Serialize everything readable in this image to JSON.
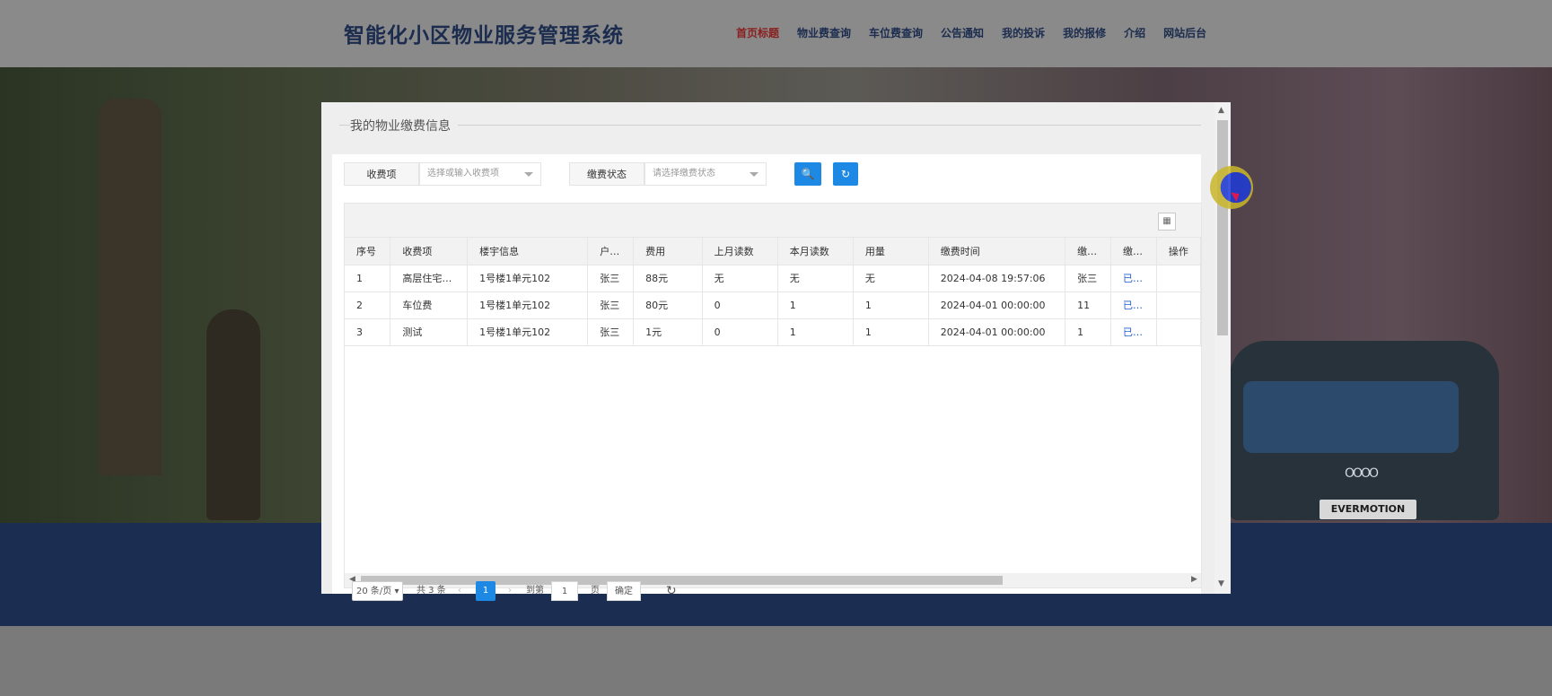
{
  "header": {
    "site_title": "智能化小区物业服务管理系统",
    "nav": [
      "首页标题",
      "物业费查询",
      "车位费查询",
      "公告通知",
      "我的投诉",
      "我的报修",
      "介绍",
      "网站后台"
    ],
    "active_index": 0,
    "active_color": "#8a1f1f"
  },
  "backdrop": {
    "car_logo": "OOOO",
    "plate": "EVERMOTION"
  },
  "modal": {
    "title": "我的物业缴费信息",
    "filters": {
      "item_label": "收费项",
      "item_placeholder": "选择或输入收费项",
      "status_label": "缴费状态",
      "status_placeholder": "请选择缴费状态",
      "search_icon": "🔍",
      "refresh_icon": "↻"
    },
    "table": {
      "columns": [
        "序号",
        "收费项",
        "楼宇信息",
        "户…",
        "费用",
        "上月读数",
        "本月读数",
        "用量",
        "缴费时间",
        "缴…",
        "缴…",
        "操作"
      ],
      "rows": [
        [
          "1",
          "高层住宅…",
          "1号楼1单元102",
          "张三",
          "88元",
          "无",
          "无",
          "无",
          "2024-04-08 19:57:06",
          "张三",
          "已…",
          ""
        ],
        [
          "2",
          "车位费",
          "1号楼1单元102",
          "张三",
          "80元",
          "0",
          "1",
          "1",
          "2024-04-01 00:00:00",
          "11",
          "已…",
          ""
        ],
        [
          "3",
          "测试",
          "1号楼1单元102",
          "张三",
          "1元",
          "0",
          "1",
          "1",
          "2024-04-01 00:00:00",
          "1",
          "已…",
          ""
        ]
      ]
    },
    "pager": {
      "page_size": "20 条/页",
      "total": "共 3 条",
      "prev": "‹",
      "current_page": "1",
      "next": "›",
      "goto_label": "到第",
      "goto_value": "1",
      "page_unit": "页",
      "confirm": "确定",
      "refresh": "↻"
    },
    "accent_color": "#1e88e5"
  }
}
